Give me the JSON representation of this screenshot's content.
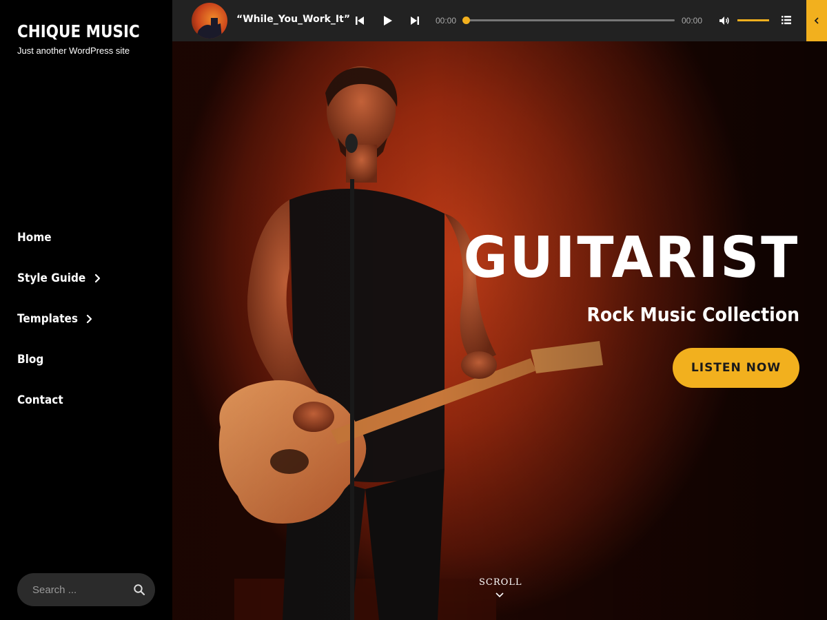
{
  "site": {
    "title": "CHIQUE MUSIC",
    "tagline": "Just another WordPress site"
  },
  "nav": {
    "items": [
      {
        "label": "Home",
        "has_submenu": false
      },
      {
        "label": "Style Guide",
        "has_submenu": true
      },
      {
        "label": "Templates",
        "has_submenu": true
      },
      {
        "label": "Blog",
        "has_submenu": false
      },
      {
        "label": "Contact",
        "has_submenu": false
      }
    ]
  },
  "search": {
    "placeholder": "Search ...",
    "icon": "search-icon"
  },
  "player": {
    "track_title": "“While_You_Work_It”",
    "current_time": "00:00",
    "duration": "00:00",
    "progress": 0,
    "volume": 1.0,
    "icons": [
      "previous-icon",
      "play-icon",
      "next-icon",
      "volume-icon",
      "playlist-icon",
      "collapse-chevron-icon"
    ]
  },
  "hero": {
    "title": "GUITARIST",
    "subtitle": "Rock Music Collection",
    "button_label": "LISTEN NOW",
    "scroll_label": "SCROLL"
  },
  "colors": {
    "accent": "#f2b01e",
    "sidebar_bg": "#000000",
    "player_bg": "#222222",
    "hero_red": "#8a2a0e"
  }
}
